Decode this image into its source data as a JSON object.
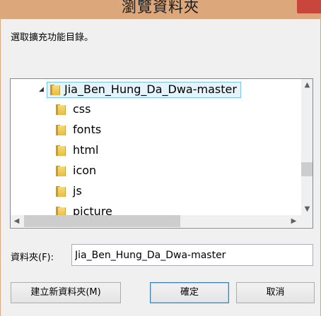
{
  "window": {
    "title": "瀏覽資料夾"
  },
  "instructions": "選取擴充功能目錄。",
  "tree": {
    "root": {
      "label": "Jia_Ben_Hung_Da_Dwa-master",
      "expanded": true,
      "selected": true
    },
    "children": [
      {
        "label": "css"
      },
      {
        "label": "fonts"
      },
      {
        "label": "html"
      },
      {
        "label": "icon"
      },
      {
        "label": "js"
      },
      {
        "label": "picture"
      }
    ]
  },
  "folder_field": {
    "label": "資料夾(F):",
    "value": "Jia_Ben_Hung_Da_Dwa-master"
  },
  "buttons": {
    "new_folder": "建立新資料夾(M)",
    "ok": "確定",
    "cancel": "取消"
  },
  "colors": {
    "titlebar": "#dba77b",
    "close": "#c9463c",
    "selection_border": "#7bc4eb",
    "selection_fill": "#e5f3fb",
    "default_button_border": "#3c7fb1"
  }
}
